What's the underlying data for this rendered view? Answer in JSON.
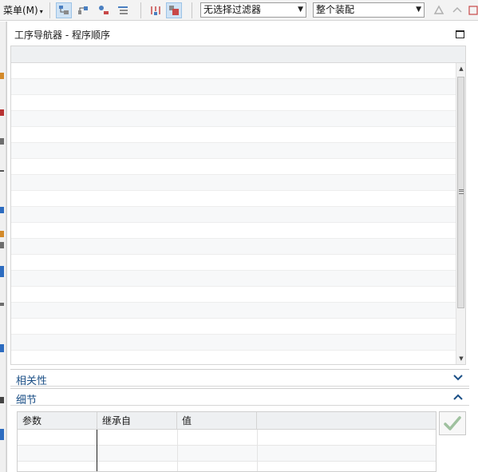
{
  "toolbar": {
    "menu_label": "菜单(M)",
    "menu_arrow": "▾",
    "selection_filter": "无选择过滤器",
    "scope_filter": "整个装配",
    "dropdown_arrow": "▼",
    "active_color": "#cfe3f5"
  },
  "navigator": {
    "title": "工序导航器 - 程序顺序",
    "rows": 19
  },
  "sections": {
    "dependencies_label": "相关性",
    "details_label": "细节",
    "accent_color": "#1b4f86"
  },
  "details_table": {
    "columns": [
      "参数",
      "继承自",
      "值",
      ""
    ]
  },
  "icons": {
    "menu": "menu-dropdown",
    "maximize": "maximize-icon",
    "expand": "chevron-down-icon",
    "collapse": "chevron-up-icon",
    "ok": "checkmark-icon",
    "scroll_up": "scroll-up-arrow",
    "scroll_down": "scroll-down-arrow"
  }
}
